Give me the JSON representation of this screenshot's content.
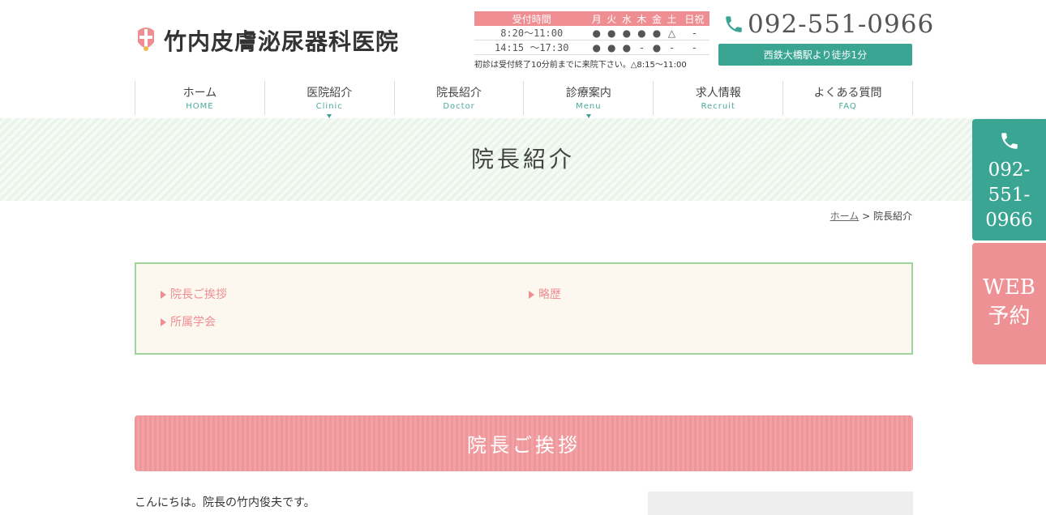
{
  "header": {
    "logo_text": "竹内皮膚泌尿器科医院",
    "phone": "092-551-0966",
    "access": "西鉄大橋駅より徒歩1分"
  },
  "hours": {
    "head": [
      "受付時間",
      "月",
      "火",
      "水",
      "木",
      "金",
      "土",
      "日祝"
    ],
    "rows": [
      {
        "time": "8:20〜11:00",
        "cells": [
          "●",
          "●",
          "●",
          "●",
          "●",
          "△",
          "-"
        ]
      },
      {
        "time": "14:15 〜17:30",
        "cells": [
          "●",
          "●",
          "●",
          "-",
          "●",
          "-",
          "-"
        ]
      }
    ],
    "note": "初診は受付終了10分前までに来院下さい。△8:15〜11:00"
  },
  "nav": [
    {
      "jp": "ホーム",
      "en": "HOME",
      "dropdown": false
    },
    {
      "jp": "医院紹介",
      "en": "Clinic",
      "dropdown": true
    },
    {
      "jp": "院長紹介",
      "en": "Doctor",
      "dropdown": false
    },
    {
      "jp": "診療案内",
      "en": "Menu",
      "dropdown": true
    },
    {
      "jp": "求人情報",
      "en": "Recruit",
      "dropdown": false
    },
    {
      "jp": "よくある質問",
      "en": "FAQ",
      "dropdown": false
    }
  ],
  "page_title": "院長紹介",
  "breadcrumb": {
    "home": "ホーム",
    "sep": ">",
    "current": "院長紹介"
  },
  "toc": [
    "院長ご挨拶",
    "略歴",
    "所属学会"
  ],
  "section_title": "院長ご挨拶",
  "intro_text": "こんにちは。院長の竹内俊夫です。",
  "side": {
    "tel": [
      "092-",
      "551-",
      "0966"
    ],
    "web_line1": "WEB",
    "web_line2": "予約"
  },
  "colors": {
    "teal": "#3aa592",
    "pink": "#ef8e92",
    "green_border": "#9fd59c",
    "cream": "#fcf8ef"
  }
}
